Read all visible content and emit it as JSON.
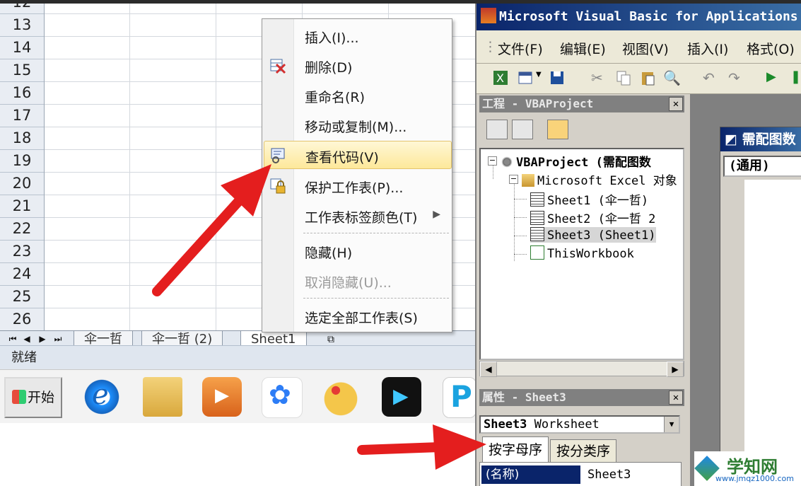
{
  "excel": {
    "row_numbers": [
      "12",
      "13",
      "14",
      "15",
      "16",
      "17",
      "18",
      "19",
      "20",
      "21",
      "22",
      "23",
      "24",
      "25",
      "26"
    ],
    "sheet_tabs": [
      "伞一哲",
      "伞一哲 (2)",
      "Sheet1"
    ],
    "status": "就绪"
  },
  "taskbar": {
    "start_label": "开始",
    "apps": [
      "internet-explorer-icon",
      "file-explorer-icon",
      "media-player-icon",
      "baidu-netdisk-icon",
      "paint-icon",
      "video-app-icon",
      "p-app-icon"
    ]
  },
  "context_menu": {
    "items": [
      {
        "label": "插入(I)..."
      },
      {
        "label": "删除(D)"
      },
      {
        "label": "重命名(R)"
      },
      {
        "label": "移动或复制(M)..."
      },
      {
        "label": "查看代码(V)"
      },
      {
        "label": "保护工作表(P)..."
      },
      {
        "label": "工作表标签颜色(T)"
      },
      {
        "label": "隐藏(H)"
      },
      {
        "label": "取消隐藏(U)..."
      },
      {
        "label": "选定全部工作表(S)"
      }
    ],
    "highlighted": "查看代码(V)"
  },
  "vba": {
    "title": "Microsoft Visual Basic for Applications",
    "menus": [
      "文件(F)",
      "编辑(E)",
      "视图(V)",
      "插入(I)",
      "格式(O)"
    ],
    "project_pane_title": "工程 - VBAProject",
    "tree": {
      "root": "VBAProject (需配图数",
      "folder": "Microsoft Excel 对象",
      "sheet1": "Sheet1 (伞一哲)",
      "sheet2": "Sheet2 (伞一哲 2",
      "sheet3": "Sheet3 (Sheet1)",
      "workbook": "ThisWorkbook"
    },
    "properties_pane_title": "属性 - Sheet3",
    "object_combo_name": "Sheet3",
    "object_combo_type": "Worksheet",
    "tabs": [
      "按字母序",
      "按分类序"
    ],
    "prop_key": "(名称)",
    "prop_value": "Sheet3",
    "code_window_title": "需配图数",
    "code_combo": "(通用)"
  },
  "watermark": {
    "name": "学知网",
    "url": "www.jmqz1000.com"
  },
  "colors": {
    "annotation_arrow": "#e41e1e",
    "menu_highlight": "#fde89a",
    "vba_titlebar": "#0a246a"
  }
}
